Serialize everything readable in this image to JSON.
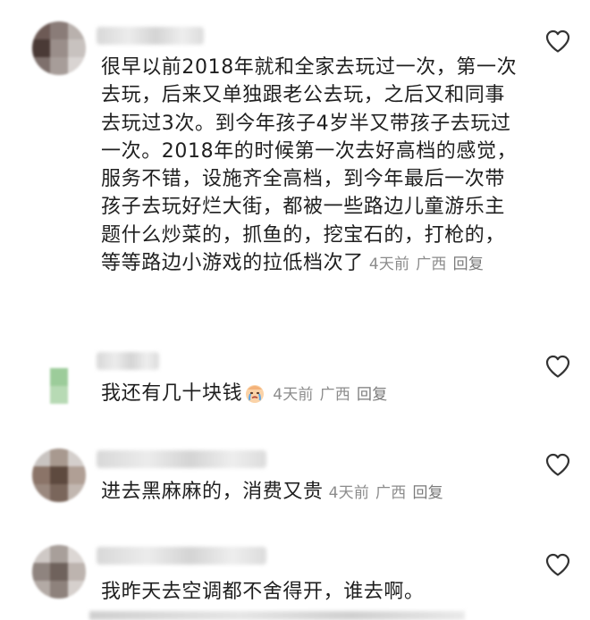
{
  "comments": [
    {
      "text": "很早以前2018年就和全家去玩过一次，第一次去玩，后来又单独跟老公去玩，之后又和同事去玩过3次。到今年孩子4岁半又带孩子去玩过一次。2018年的时候第一次去好高档的感觉，服务不错，设施齐全高档，到今年最后一次带孩子去玩好烂大街，都被一些路边儿童游乐主题什么炒菜的，抓鱼的，挖宝石的，打枪的，等等路边小游戏的拉低档次了",
      "time": "4天前",
      "location": "广西",
      "reply_label": "回复",
      "like_icon": "heart-outline-icon"
    },
    {
      "text": "我还有几十块钱",
      "emoji": "crying-face-emoji",
      "time": "4天前",
      "location": "广西",
      "reply_label": "回复",
      "like_icon": "heart-outline-icon"
    },
    {
      "text": "进去黑麻麻的，消费又贵",
      "time": "4天前",
      "location": "广西",
      "reply_label": "回复",
      "like_icon": "heart-outline-icon"
    },
    {
      "text": "我昨天去空调都不舍得开，谁去啊。",
      "like_icon": "heart-outline-icon"
    }
  ],
  "colors": {
    "text": "#1f1f1f",
    "meta": "#8c8c8c",
    "icon": "#333333",
    "background": "#ffffff"
  }
}
